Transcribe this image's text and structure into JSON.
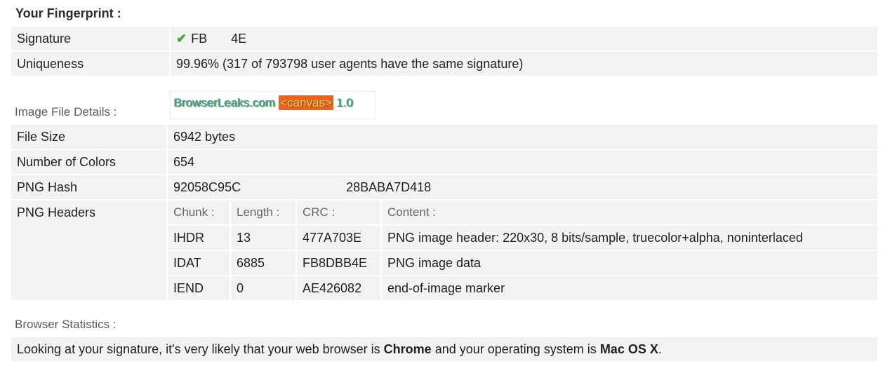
{
  "fingerprint": {
    "title": "Your Fingerprint :",
    "signature_label": "Signature",
    "signature_prefix": "FB",
    "signature_suffix": "4E",
    "uniqueness_label": "Uniqueness",
    "uniqueness_value": "99.96% (317 of 793798 user agents have the same signature)"
  },
  "image_file": {
    "section_label": "Image File Details :",
    "canvas_text_a": "BrowserLeaks.com ",
    "canvas_text_b": "<canvas>",
    "canvas_text_c": " 1.0",
    "file_size_label": "File Size",
    "file_size_value": "6942 bytes",
    "colors_label": "Number of Colors",
    "colors_value": "654",
    "hash_label": "PNG Hash",
    "hash_prefix": "92058C95C",
    "hash_suffix": "28BABA7D418",
    "headers_label": "PNG Headers",
    "headers_columns": [
      "Chunk :",
      "Length :",
      "CRC :",
      "Content :"
    ],
    "headers_rows": [
      [
        "IHDR",
        "13",
        "477A703E",
        "PNG image header: 220x30, 8 bits/sample, truecolor+alpha, noninterlaced"
      ],
      [
        "IDAT",
        "6885",
        "FB8DBB4E",
        "PNG image data"
      ],
      [
        "IEND",
        "0",
        "AE426082",
        "end-of-image marker"
      ]
    ]
  },
  "browser_stats": {
    "section_label": "Browser Statistics :",
    "text_before": "Looking at your signature, it's very likely that your web browser is ",
    "browser": "Chrome",
    "text_middle": " and your operating system is ",
    "os": "Mac OS X",
    "text_end": "."
  },
  "colors": {
    "row_bg": "#f2f2f2",
    "check": "#3ea14a",
    "canvas_highlight": "#e8641e"
  }
}
